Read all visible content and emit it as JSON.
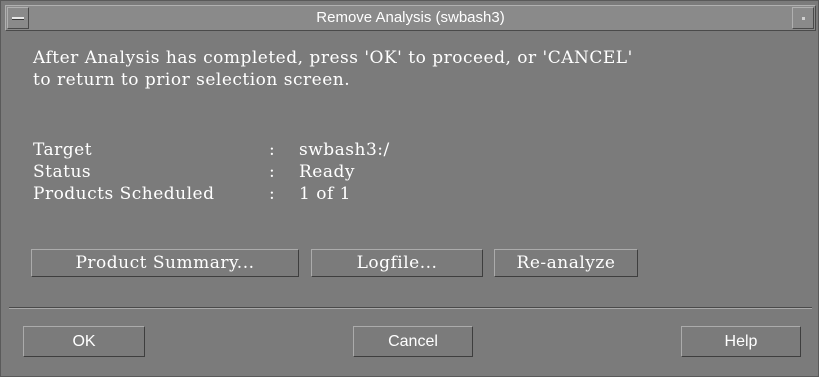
{
  "window": {
    "title": "Remove Analysis (swbash3)"
  },
  "message": {
    "line1": "After Analysis has completed, press 'OK' to proceed, or 'CANCEL'",
    "line2": "to return to prior selection screen."
  },
  "info": [
    {
      "label": "Target",
      "separator": ":",
      "value": "swbash3:/"
    },
    {
      "label": "Status",
      "separator": ":",
      "value": "Ready"
    },
    {
      "label": "Products Scheduled",
      "separator": ":",
      "value": "1 of 1"
    }
  ],
  "action_buttons": {
    "product_summary": "Product Summary...",
    "logfile": "Logfile...",
    "reanalyze": "Re-analyze"
  },
  "dialog_buttons": {
    "ok": "OK",
    "cancel": "Cancel",
    "help": "Help"
  }
}
